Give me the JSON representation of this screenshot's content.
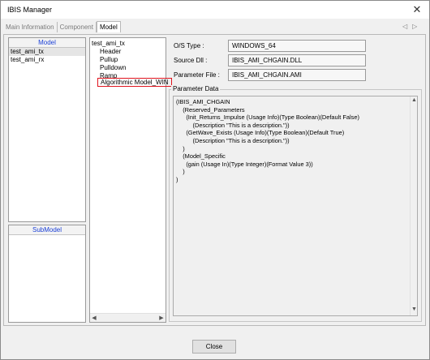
{
  "window": {
    "title": "IBIS Manager",
    "close_glyph": "✕"
  },
  "tabs": [
    {
      "label": "Main Information"
    },
    {
      "label": "Component"
    },
    {
      "label": "Model"
    }
  ],
  "tab_nav": {
    "left": "◁",
    "right": "▷"
  },
  "model_list": {
    "header": "Model",
    "items": [
      "test_ami_tx",
      "test_ami_rx"
    ]
  },
  "submodel_list": {
    "header": "SubModel"
  },
  "tree": {
    "root": "test_ami_tx",
    "children": [
      "Header",
      "Pullup",
      "Pulldown",
      "Ramp",
      "Algorithmic Model_WIN"
    ]
  },
  "fields": {
    "os_type": {
      "label": "O/S Type    :",
      "value": "WINDOWS_64"
    },
    "source_dll": {
      "label": "Source Dll  :",
      "value": "IBIS_AMI_CHGAIN.DLL"
    },
    "parameter_file": {
      "label": "Parameter File   :",
      "value": "IBIS_AMI_CHGAIN.AMI"
    }
  },
  "parameter_data": {
    "title": "Parameter Data",
    "text": "(IBIS_AMI_CHGAIN\n    (Reserved_Parameters\n      (Init_Returns_Impulse (Usage Info)(Type Boolean)(Default False)\n          (Description \"This is a description.\"))\n      (GetWave_Exists (Usage Info)(Type Boolean)(Default True)\n          (Description \"This is a description.\"))\n    )\n    (Model_Specific\n      (gain (Usage In)(Type Integer)(Format Value 3))\n    )\n)"
  },
  "buttons": {
    "close": "Close"
  },
  "scroll_arrows": {
    "up": "▲",
    "down": "▼",
    "left": "◀",
    "right": "▶"
  }
}
